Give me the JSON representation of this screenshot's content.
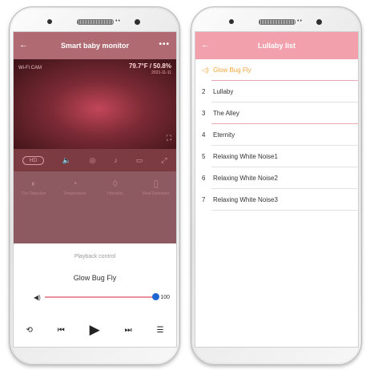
{
  "left_screen": {
    "title": "Smart baby monitor",
    "camera": {
      "temperature": "79.7°F / 50.8%",
      "timestamp": "2021-11-11",
      "logo": "Wi-Fi CAM"
    },
    "controls": {
      "hd": "HD"
    },
    "features": [
      "Cry Detection",
      "Temperature",
      "Humidity",
      "Meal Reminder"
    ],
    "playback": {
      "title": "Playback control",
      "song": "Glow Bug Fly",
      "volume_value": 100,
      "volume_fraction": 1.0
    }
  },
  "right_screen": {
    "title": "Lullaby list",
    "songs": [
      {
        "num": "",
        "name": "Glow Bug Fly"
      },
      {
        "num": "2",
        "name": "Lullaby"
      },
      {
        "num": "3",
        "name": "The Alley"
      },
      {
        "num": "4",
        "name": "Eternity"
      },
      {
        "num": "5",
        "name": "Relaxing White Noise1"
      },
      {
        "num": "6",
        "name": "Relaxing White Noise2"
      },
      {
        "num": "7",
        "name": "Relaxing White Noise3"
      }
    ]
  },
  "colors": {
    "accent_pink": "#f2a0ac",
    "playing_orange": "#f2a63a",
    "slider_knob": "#1e66d0"
  }
}
